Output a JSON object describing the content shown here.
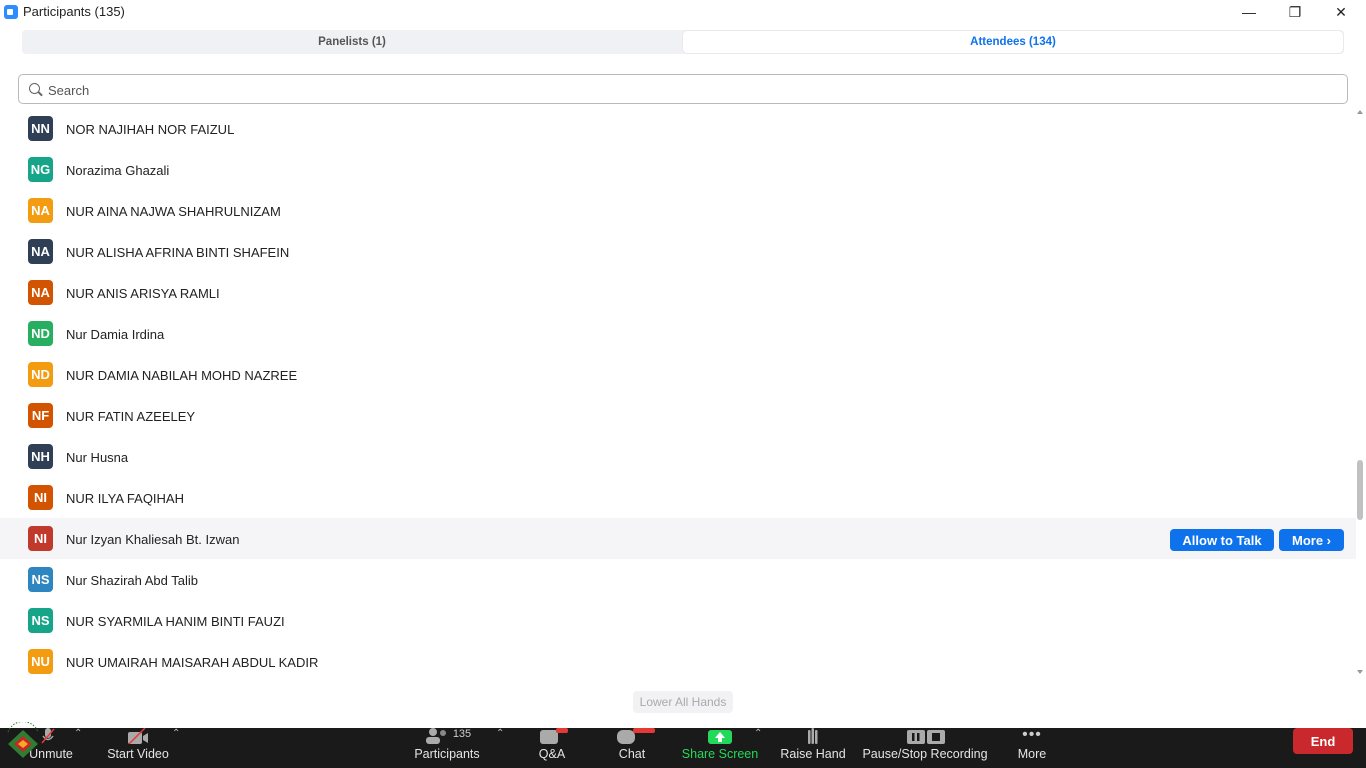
{
  "window": {
    "title": "Participants (135)",
    "minimize": "—",
    "restore": "❐",
    "close": "✕"
  },
  "tabs": [
    {
      "label": "Panelists (1)",
      "active": false
    },
    {
      "label": "Attendees (134)",
      "active": true
    }
  ],
  "search": {
    "placeholder": "Search",
    "value": ""
  },
  "attendees": [
    {
      "initials": "NN",
      "name": "NOR NAJIHAH NOR FAIZUL",
      "color": "#2f3f56"
    },
    {
      "initials": "NG",
      "name": "Norazima Ghazali",
      "color": "#17a589"
    },
    {
      "initials": "NA",
      "name": "NUR AINA NAJWA SHAHRULNIZAM",
      "color": "#f39c12"
    },
    {
      "initials": "NA",
      "name": "NUR ALISHA AFRINA BINTI SHAFEIN",
      "color": "#2f3f56"
    },
    {
      "initials": "NA",
      "name": "NUR ANIS ARISYA RAMLI",
      "color": "#d35400"
    },
    {
      "initials": "ND",
      "name": "Nur Damia Irdina",
      "color": "#27ae60"
    },
    {
      "initials": "ND",
      "name": "NUR DAMIA NABILAH MOHD NAZREE",
      "color": "#f39c12"
    },
    {
      "initials": "NF",
      "name": "NUR FATIN AZEELEY",
      "color": "#d35400"
    },
    {
      "initials": "NH",
      "name": "Nur Husna",
      "color": "#2f3f56"
    },
    {
      "initials": "NI",
      "name": "NUR ILYA FAQIHAH",
      "color": "#d35400"
    },
    {
      "initials": "NI",
      "name": "Nur Izyan Khaliesah Bt. Izwan",
      "color": "#c0392b"
    },
    {
      "initials": "NS",
      "name": "Nur Shazirah Abd Talib",
      "color": "#2e86c1"
    },
    {
      "initials": "NS",
      "name": "NUR SYARMILA HANIM BINTI FAUZI",
      "color": "#17a589"
    },
    {
      "initials": "NU",
      "name": "NUR UMAIRAH MAISARAH ABDUL KADIR",
      "color": "#f39c12"
    }
  ],
  "row_actions": {
    "allow_to_talk": "Allow to Talk",
    "more": "More ›"
  },
  "lower_all_hands": "Lower All Hands",
  "toolbar": {
    "unmute": "Unmute",
    "start_video": "Start Video",
    "participants": "Participants",
    "participants_count": "135",
    "qa": "Q&A",
    "chat": "Chat",
    "share_screen": "Share Screen",
    "raise_hand": "Raise Hand",
    "recording": "Pause/Stop Recording",
    "more": "More",
    "end": "End"
  },
  "colors": {
    "accent": "#0E72ED",
    "end": "#c9282d",
    "share": "#23d959",
    "toolbar_bg": "#1a1a1a"
  }
}
